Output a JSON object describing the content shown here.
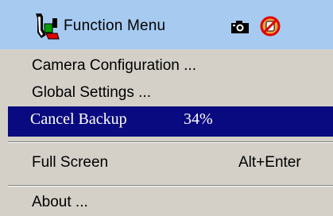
{
  "header": {
    "title": "Function Menu",
    "icons": [
      "tools-icon",
      "camera-icon",
      "no-smoking-icon"
    ],
    "background": "#a6caf0"
  },
  "menu": {
    "camera_configuration": "Camera Configuration ...",
    "global_settings": "Global Settings ...",
    "cancel_backup": "Cancel Backup",
    "cancel_backup_progress": "34%",
    "full_screen": "Full Screen",
    "full_screen_shortcut": "Alt+Enter",
    "about": "About ..."
  },
  "colors": {
    "menu_background": "#d4d0c8",
    "highlight": "#0a0a80",
    "highlight_text": "#ffffff"
  }
}
